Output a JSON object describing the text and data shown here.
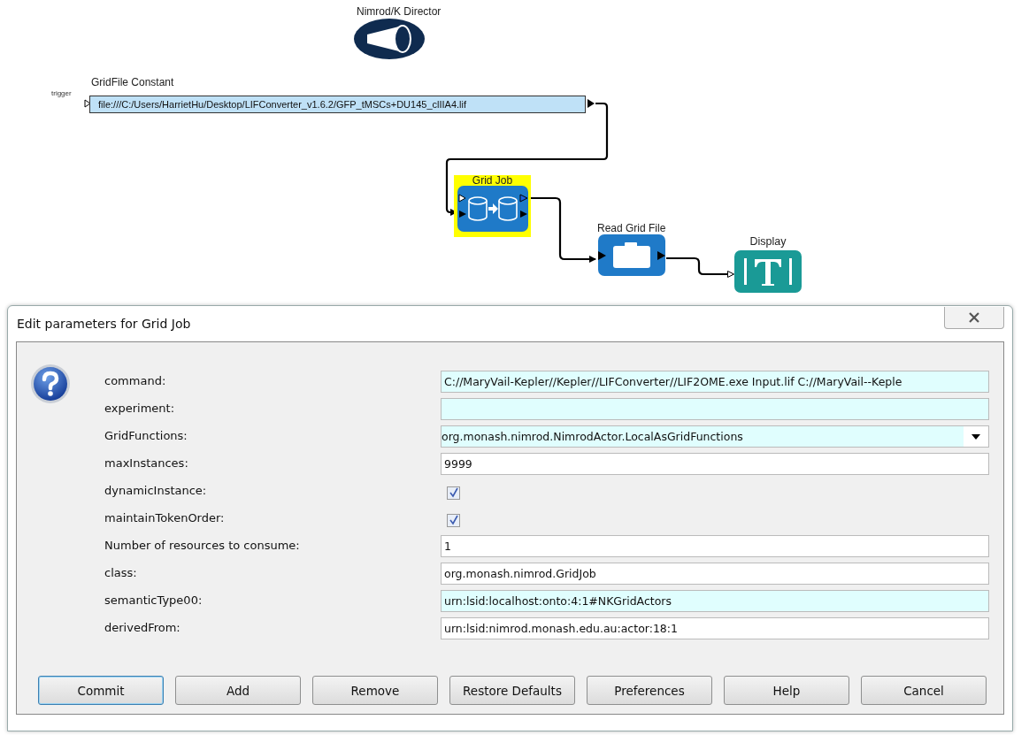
{
  "diagram": {
    "director": {
      "label": "Nimrod/K Director"
    },
    "constant": {
      "label": "GridFile Constant",
      "port_label": "trigger",
      "value": "file:///C:/Users/HarrietHu/Desktop/LIFConverter_v1.6.2/GFP_tMSCs+DU145_clIIA4.lif"
    },
    "actors": [
      {
        "kind": "gridjob",
        "label": "Grid Job",
        "selected": true
      },
      {
        "kind": "reader",
        "label": "Read Grid File",
        "selected": false
      },
      {
        "kind": "display",
        "label": "Display",
        "selected": false
      }
    ]
  },
  "dialog": {
    "title": "Edit parameters for Grid Job",
    "params": [
      {
        "kind": "text",
        "label": "command:",
        "value": "C://MaryVail-Kepler//Kepler//LIFConverter//LIF2OME.exe Input.lif C://MaryVail--Keple",
        "highlighted": true
      },
      {
        "kind": "text",
        "label": "experiment:",
        "highlighted": true
      },
      {
        "kind": "choice",
        "label": "GridFunctions:",
        "value": "org.monash.nimrod.NimrodActor.LocalAsGridFunctions",
        "highlighted": true
      },
      {
        "kind": "text",
        "label": "maxInstances:",
        "value": "9999",
        "highlighted": false
      },
      {
        "kind": "checkbox",
        "label": "dynamicInstance:",
        "checked": true
      },
      {
        "kind": "checkbox",
        "label": "maintainTokenOrder:",
        "checked": true
      },
      {
        "kind": "text",
        "label": "Number of resources to consume:",
        "value": "1",
        "highlighted": false
      },
      {
        "kind": "text",
        "label": "class:",
        "value": "org.monash.nimrod.GridJob",
        "highlighted": false
      },
      {
        "kind": "text",
        "label": "semanticType00:",
        "value": "urn:lsid:localhost:onto:4:1#NKGridActors",
        "highlighted": true
      },
      {
        "kind": "text",
        "label": "derivedFrom:",
        "value": "urn:lsid:nimrod.monash.edu.au:actor:18:1",
        "highlighted": false
      }
    ],
    "buttons": [
      {
        "label": "Commit",
        "focused": true
      },
      {
        "label": "Add",
        "focused": false
      },
      {
        "label": "Remove",
        "focused": false
      },
      {
        "label": "Restore Defaults",
        "focused": false
      },
      {
        "label": "Preferences",
        "focused": false
      },
      {
        "label": "Help",
        "focused": false
      },
      {
        "label": "Cancel",
        "focused": false
      }
    ]
  }
}
